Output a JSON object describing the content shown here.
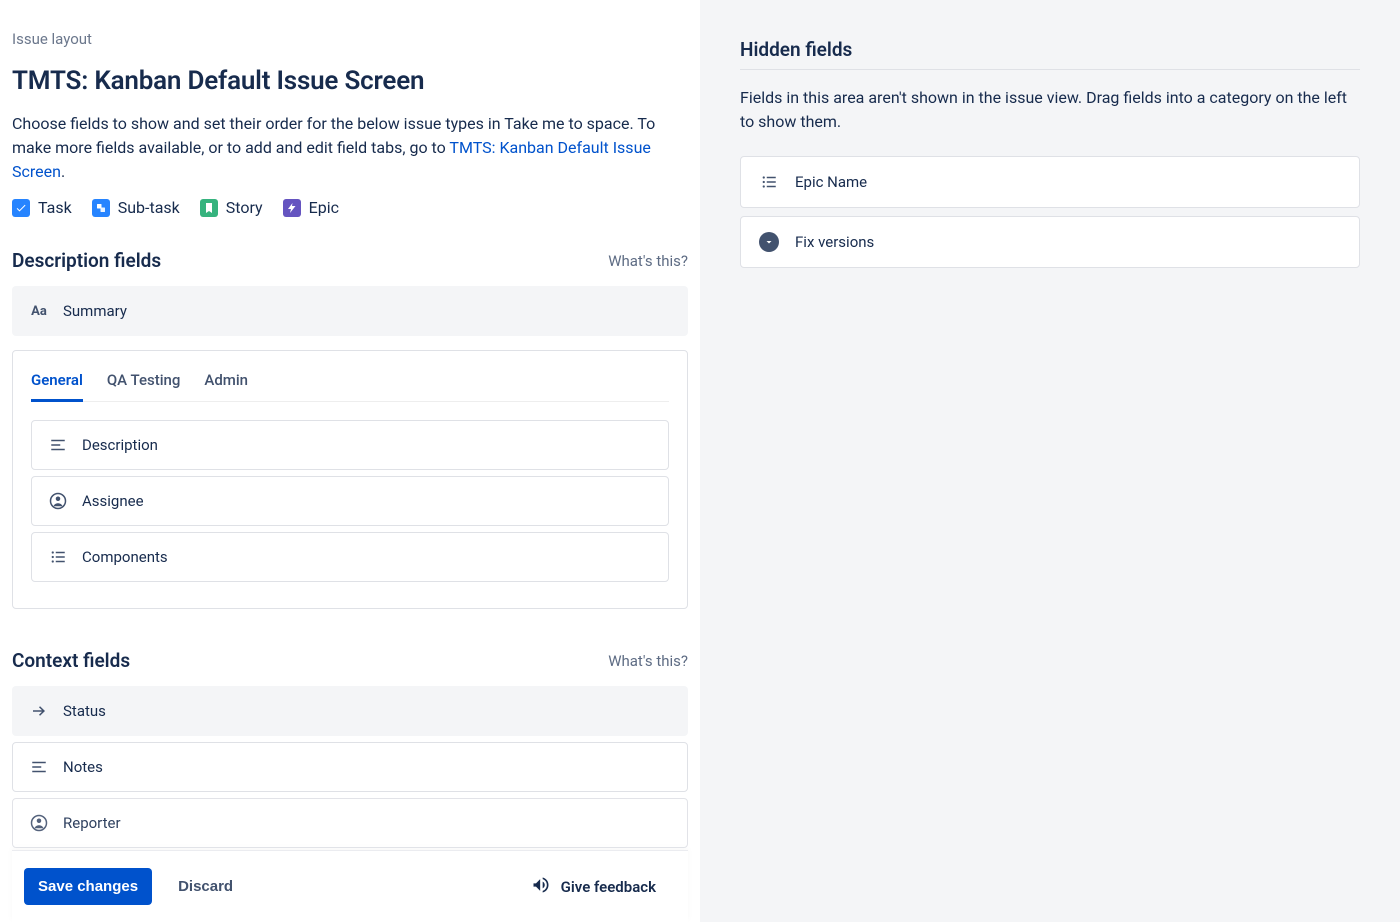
{
  "breadcrumb": "Issue layout",
  "page_title": "TMTS: Kanban Default Issue Screen",
  "intro_text_1": "Choose fields to show and set their order for the below issue types in Take me to space. To make more fields available, or to add and edit field tabs, go to ",
  "intro_link": "TMTS: Kanban Default Issue Screen",
  "intro_text_2": ".",
  "issue_types": [
    {
      "label": "Task"
    },
    {
      "label": "Sub-task"
    },
    {
      "label": "Story"
    },
    {
      "label": "Epic"
    }
  ],
  "sections": {
    "description": {
      "title": "Description fields",
      "whats_this": "What's this?",
      "locked_field": "Summary",
      "tabs": [
        {
          "label": "General",
          "active": true
        },
        {
          "label": "QA Testing",
          "active": false
        },
        {
          "label": "Admin",
          "active": false
        }
      ],
      "fields": [
        {
          "label": "Description",
          "icon": "text"
        },
        {
          "label": "Assignee",
          "icon": "person"
        },
        {
          "label": "Components",
          "icon": "list"
        }
      ]
    },
    "context": {
      "title": "Context fields",
      "whats_this": "What's this?",
      "locked_field": "Status",
      "fields": [
        {
          "label": "Notes",
          "icon": "text"
        },
        {
          "label": "Reporter",
          "icon": "person"
        }
      ]
    }
  },
  "footer": {
    "save": "Save changes",
    "discard": "Discard",
    "feedback": "Give feedback"
  },
  "hidden": {
    "title": "Hidden fields",
    "desc": "Fields in this area aren't shown in the issue view. Drag fields into a category on the left to show them.",
    "fields": [
      {
        "label": "Epic Name",
        "icon": "list"
      },
      {
        "label": "Fix versions",
        "icon": "chevron"
      }
    ]
  }
}
